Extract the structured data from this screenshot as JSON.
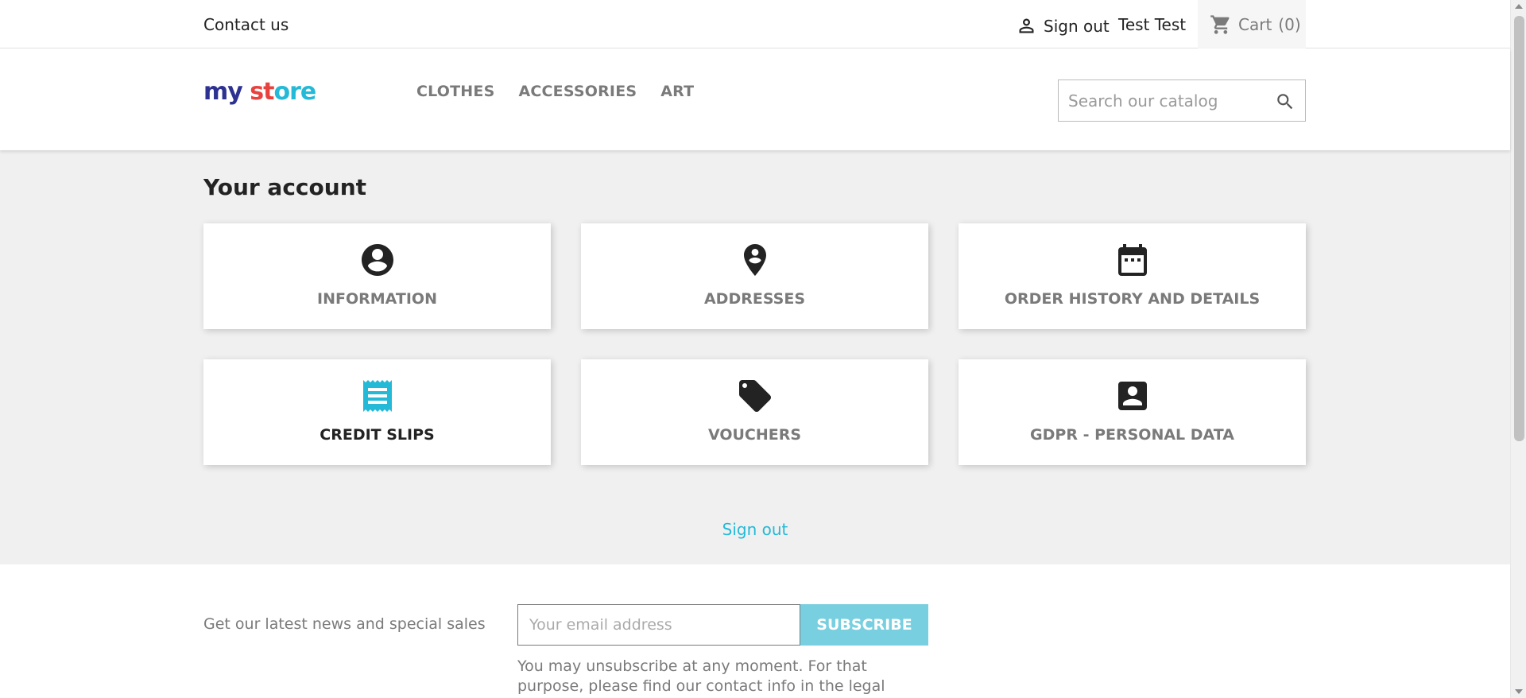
{
  "topbar": {
    "contact_label": "Contact us",
    "signout_label": "Sign out",
    "username": "Test Test",
    "cart_label": "Cart",
    "cart_count": "(0)"
  },
  "header": {
    "logo": {
      "part1": "my",
      "part2": "st",
      "part3": "ore"
    },
    "nav": [
      "CLOTHES",
      "ACCESSORIES",
      "ART"
    ],
    "search_placeholder": "Search our catalog"
  },
  "main": {
    "title": "Your account",
    "cards": [
      {
        "label": "INFORMATION",
        "icon": "account-circle-icon"
      },
      {
        "label": "ADDRESSES",
        "icon": "location-pin-icon"
      },
      {
        "label": "ORDER HISTORY AND DETAILS",
        "icon": "calendar-icon"
      },
      {
        "label": "CREDIT SLIPS",
        "icon": "receipt-icon"
      },
      {
        "label": "VOUCHERS",
        "icon": "tag-icon"
      },
      {
        "label": "GDPR - PERSONAL DATA",
        "icon": "contact-card-icon"
      }
    ],
    "signout_label": "Sign out"
  },
  "footer": {
    "newsletter_text": "Get our latest news and special sales",
    "email_placeholder": "Your email address",
    "subscribe_label": "SUBSCRIBE",
    "disclaimer": "You may unsubscribe at any moment. For that purpose, please find our contact info in the legal notice."
  },
  "colors": {
    "accent": "#24b9d7",
    "subscribe_bg": "#78cfe0",
    "page_bg": "#f0f0f0",
    "text_muted": "#7a7a7a",
    "text_dark": "#232323"
  }
}
